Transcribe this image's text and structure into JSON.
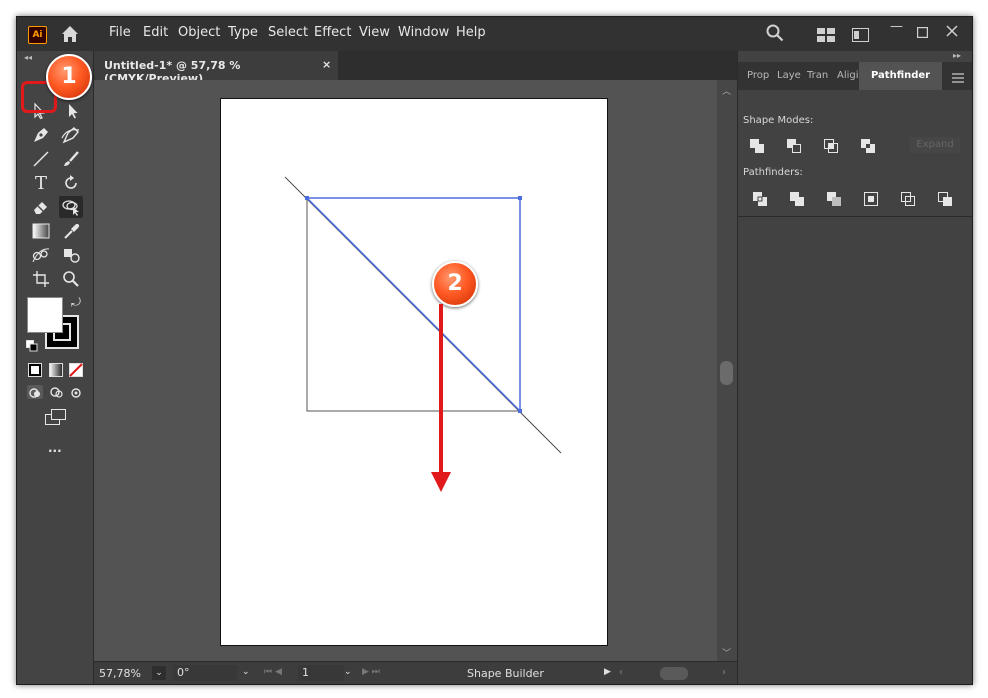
{
  "app": {
    "logo_text": "Ai",
    "menu": [
      "File",
      "Edit",
      "Object",
      "Type",
      "Select",
      "Effect",
      "View",
      "Window",
      "Help"
    ]
  },
  "document": {
    "tab_title": "Untitled-1* @ 57,78 % (CMYK/Preview)",
    "close_glyph": "×"
  },
  "panel": {
    "tabs": [
      "Prop",
      "Laye",
      "Tran",
      "Aligi",
      "Pathfinder"
    ],
    "active_tab": "Pathfinder",
    "shape_modes_label": "Shape Modes:",
    "pathfinders_label": "Pathfinders:",
    "expand_label": "Expand"
  },
  "status": {
    "zoom": "57,78%",
    "rotation": "0°",
    "artboard_number": "1",
    "current_tool": "Shape Builder"
  },
  "toolbar": {
    "more_tools": "..."
  },
  "annotations": {
    "step1": "1",
    "step2": "2"
  },
  "colors": {
    "selection": "#4a6ee0",
    "annotation": "#e0191b",
    "accent": "#ff9a00"
  }
}
